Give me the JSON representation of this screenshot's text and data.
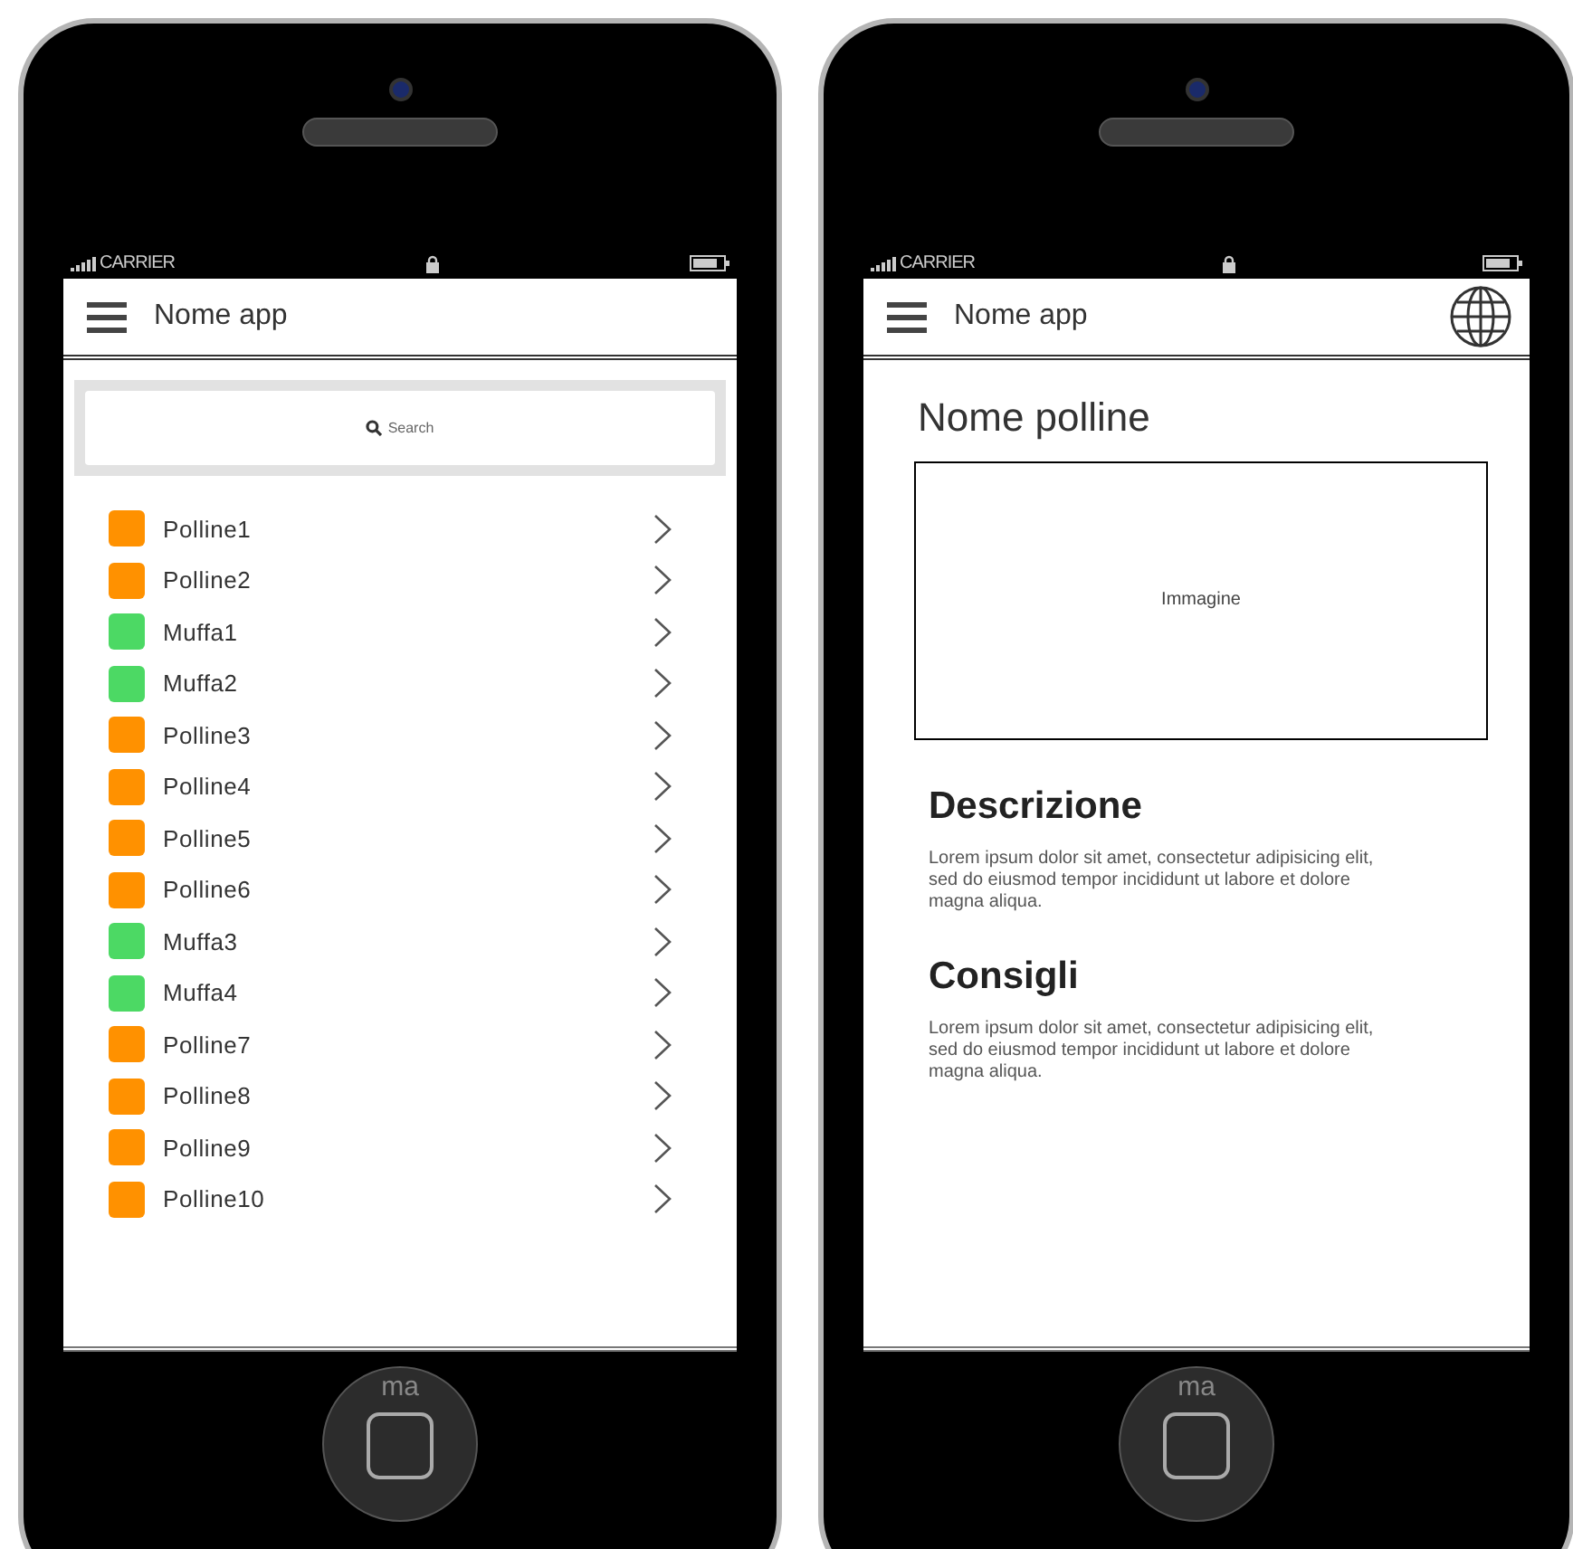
{
  "phones": [
    {
      "kind": "list",
      "status": {
        "carrier": "CARRIER"
      },
      "header": {
        "title": "Nome app",
        "globe": false
      },
      "search": {
        "placeholder": "Search"
      },
      "items": [
        {
          "label": "Polline1",
          "color": "#ff9100"
        },
        {
          "label": "Polline2",
          "color": "#ff9100"
        },
        {
          "label": "Muffa1",
          "color": "#4cd964"
        },
        {
          "label": "Muffa2",
          "color": "#4cd964"
        },
        {
          "label": "Polline3",
          "color": "#ff9100"
        },
        {
          "label": "Polline4",
          "color": "#ff9100"
        },
        {
          "label": "Polline5",
          "color": "#ff9100"
        },
        {
          "label": "Polline6",
          "color": "#ff9100"
        },
        {
          "label": "Muffa3",
          "color": "#4cd964"
        },
        {
          "label": "Muffa4",
          "color": "#4cd964"
        },
        {
          "label": "Polline7",
          "color": "#ff9100"
        },
        {
          "label": "Polline8",
          "color": "#ff9100"
        },
        {
          "label": "Polline9",
          "color": "#ff9100"
        },
        {
          "label": "Polline10",
          "color": "#ff9100"
        }
      ],
      "home": {
        "label": "ma"
      }
    },
    {
      "kind": "detail",
      "status": {
        "carrier": "CARRIER"
      },
      "header": {
        "title": "Nome app",
        "globe": true
      },
      "title": "Nome polline",
      "image": {
        "label": "Immagine"
      },
      "sections": [
        {
          "heading": "Descrizione",
          "text": "Lorem ipsum dolor sit amet, consectetur adipisicing elit, sed do eiusmod tempor incididunt ut labore et dolore magna aliqua."
        },
        {
          "heading": "Consigli",
          "text": "Lorem ipsum dolor sit amet, consectetur adipisicing elit, sed do eiusmod tempor incididunt ut labore et dolore magna aliqua."
        }
      ],
      "home": {
        "label": "ma"
      }
    }
  ]
}
